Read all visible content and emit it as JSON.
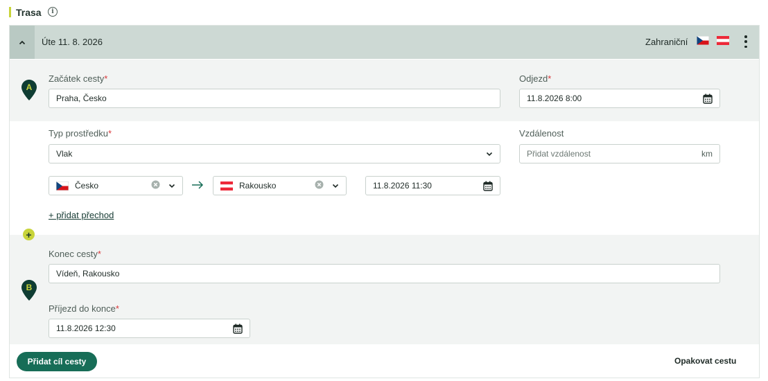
{
  "section": {
    "title": "Trasa",
    "info_icon": "info-icon"
  },
  "trip": {
    "date_label": "Úte 11. 8. 2026",
    "type_label": "Zahraniční",
    "flags": [
      "cz-flag",
      "at-flag"
    ],
    "collapse_icon": "chevron-up-icon",
    "menu_icon": "more-vertical-icon"
  },
  "start": {
    "marker_letter": "A",
    "label": "Začátek cesty",
    "value": "Praha, Česko",
    "departure_label": "Odjezd",
    "departure_value": "11.8.2026 8:00"
  },
  "transport": {
    "label": "Typ prostředku",
    "value": "Vlak",
    "distance_label": "Vzdálenost",
    "distance_placeholder": "Přidat vzdálenost",
    "distance_unit": "km"
  },
  "border_crossing": {
    "from_country": "Česko",
    "to_country": "Rakousko",
    "datetime": "11.8.2026 11:30",
    "add_link": "+ přidat přechod"
  },
  "end": {
    "marker_letter": "B",
    "label": "Konec cesty",
    "value": "Vídeň, Rakousko",
    "arrival_label": "Příjezd do konce",
    "arrival_value": "11.8.2026 12:30"
  },
  "actions": {
    "add_destination": "Přidat cíl cesty",
    "repeat_trip": "Opakovat cestu"
  },
  "required_mark": "*",
  "colors": {
    "accent_yellow": "#c8d43a",
    "primary_green": "#176d57",
    "dark_green": "#0f3d33",
    "header_bg": "#cdd9d4",
    "required": "#d9383a"
  }
}
